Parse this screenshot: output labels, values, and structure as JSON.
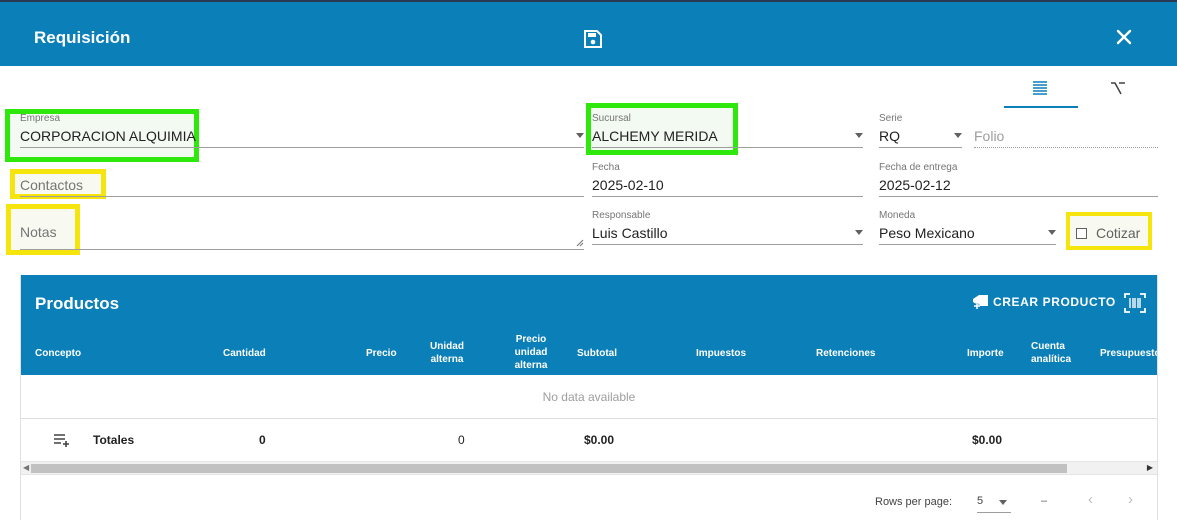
{
  "header": {
    "title": "Requisición"
  },
  "form": {
    "empresa": {
      "label": "Empresa",
      "value": "CORPORACION ALQUIMIA"
    },
    "sucursal": {
      "label": "Sucursal",
      "value": "ALCHEMY MERIDA"
    },
    "serie": {
      "label": "Serie",
      "value": "RQ"
    },
    "folio": {
      "placeholder": "Folio"
    },
    "contactos": {
      "placeholder": "Contactos"
    },
    "fecha": {
      "label": "Fecha",
      "value": "2025-02-10"
    },
    "fecha_entrega": {
      "label": "Fecha de entrega",
      "value": "2025-02-12"
    },
    "notas": {
      "placeholder": "Notas"
    },
    "responsable": {
      "label": "Responsable",
      "value": "Luis Castillo"
    },
    "moneda": {
      "label": "Moneda",
      "value": "Peso Mexicano"
    },
    "cotizar": {
      "label": "Cotizar",
      "checked": false
    }
  },
  "productos": {
    "title": "Productos",
    "crear_label": "CREAR PRODUCTO",
    "columns": {
      "concepto": "Concepto",
      "cantidad": "Cantidad",
      "precio": "Precio",
      "unidad_alterna_1": "Unidad",
      "unidad_alterna_2": "alterna",
      "precio_unidad_1": "Precio",
      "precio_unidad_2": "unidad",
      "precio_unidad_3": "alterna",
      "subtotal": "Subtotal",
      "impuestos": "Impuestos",
      "retenciones": "Retenciones",
      "importe": "Importe",
      "cuenta_1": "Cuenta",
      "cuenta_2": "analítica",
      "presupuesto": "Presupuesto"
    },
    "no_data": "No data available",
    "totals": {
      "label": "Totales",
      "cantidad": "0",
      "unidad_alterna": "0",
      "subtotal": "$0.00",
      "importe": "$0.00"
    },
    "footer": {
      "rows_per_page_label": "Rows per page:",
      "rows_per_page": "5",
      "range": "–",
      "prev": "‹",
      "next": "›"
    }
  },
  "icons": {
    "save": "save-icon",
    "close": "close-icon",
    "form_view": "list-icon",
    "tree_view": "branch-icon",
    "crear": "add-product-icon",
    "barcode": "barcode-scan-icon",
    "add_row": "add-row-icon"
  },
  "colors": {
    "primary": "#0b7fb8",
    "highlight_green": "#2ee80b",
    "highlight_yellow": "#f5e50c"
  }
}
